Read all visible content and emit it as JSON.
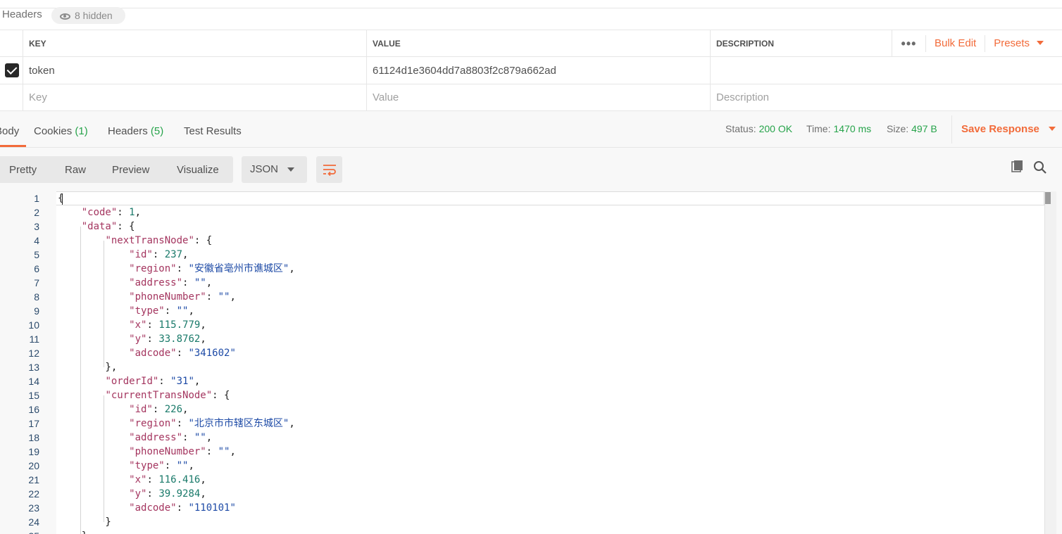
{
  "headers_bar": {
    "title": "Headers",
    "hidden_label": "8 hidden"
  },
  "params_table": {
    "columns": {
      "key": "KEY",
      "value": "VALUE",
      "description": "DESCRIPTION"
    },
    "actions": {
      "bulk_edit": "Bulk Edit",
      "presets": "Presets"
    },
    "rows": [
      {
        "checked": true,
        "key": "token",
        "value": "61124d1e3604dd7a8803f2c879a662ad",
        "description": ""
      }
    ],
    "placeholders": {
      "key": "Key",
      "value": "Value",
      "description": "Description"
    }
  },
  "response": {
    "tabs": [
      {
        "label": "Body",
        "count": ""
      },
      {
        "label": "Cookies",
        "count": "(1)"
      },
      {
        "label": "Headers",
        "count": "(5)"
      },
      {
        "label": "Test Results",
        "count": ""
      }
    ],
    "status_label": "Status:",
    "status_value": "200 OK",
    "time_label": "Time:",
    "time_value": "1470 ms",
    "size_label": "Size:",
    "size_value": "497 B",
    "save_label": "Save Response",
    "accent_color": "#f26b3a",
    "success_color": "#26a34a"
  },
  "view_modes": [
    "Pretty",
    "Raw",
    "Preview",
    "Visualize"
  ],
  "format": "JSON",
  "icons": [
    "eye-icon",
    "wrap-lines-icon",
    "copy-icon",
    "search-icon",
    "chevron-down-icon"
  ],
  "code_lines": [
    "{",
    "    \"code\": 1,",
    "    \"data\": {",
    "        \"nextTransNode\": {",
    "            \"id\": 237,",
    "            \"region\": \"安徽省亳州市谯城区\",",
    "            \"address\": \"\",",
    "            \"phoneNumber\": \"\",",
    "            \"type\": \"\",",
    "            \"x\": 115.779,",
    "            \"y\": 33.8762,",
    "            \"adcode\": \"341602\"",
    "        },",
    "        \"orderId\": \"31\",",
    "        \"currentTransNode\": {",
    "            \"id\": 226,",
    "            \"region\": \"北京市市辖区东城区\",",
    "            \"address\": \"\",",
    "            \"phoneNumber\": \"\",",
    "            \"type\": \"\",",
    "            \"x\": 116.416,",
    "            \"y\": 39.9284,",
    "            \"adcode\": \"110101\"",
    "        }",
    "    },"
  ]
}
